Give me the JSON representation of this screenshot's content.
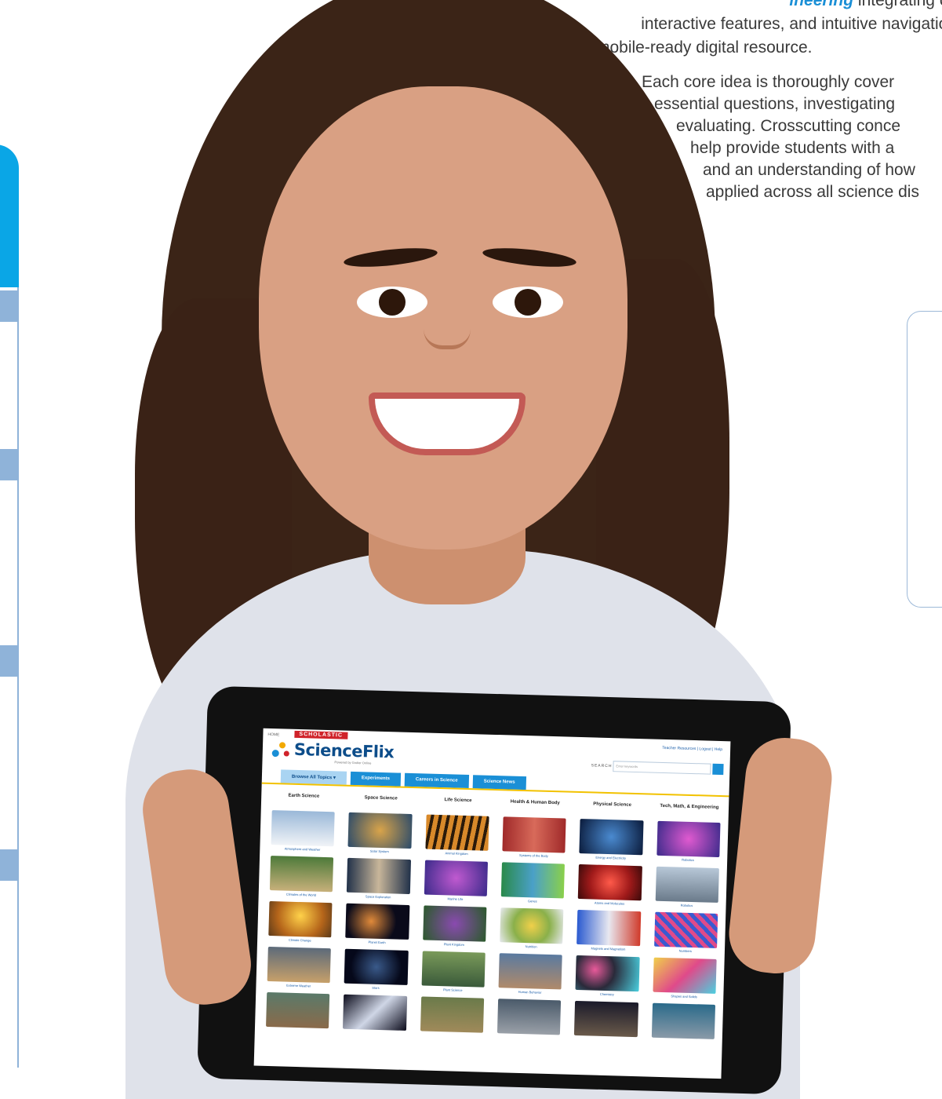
{
  "text": {
    "line0_hl": "ineering",
    "line0_tail": " integrating cu",
    "line1": "interactive features, and intuitive navigation",
    "line2": "mobile-ready digital resource.",
    "para2": [
      "Each core idea is thoroughly cover",
      "essential questions, investigating",
      "evaluating. Crosscutting conce",
      "help provide students with a",
      "and an understanding of how",
      "applied across all science dis"
    ]
  },
  "tablet": {
    "top_link": "HOME",
    "scholastic": "SCHOLASTIC",
    "logo": "ScienceFlix",
    "powered": "Powered by Grolier Online",
    "right_links": "Teacher Resources  |  Logout  |  Help",
    "search_label": "SEARCH",
    "search_placeholder": "Enter keywords",
    "tabs": [
      "Browse All Topics  ▾",
      "Experiments",
      "Careers in Science",
      "Science News"
    ],
    "columns": [
      {
        "head": "Earth Science",
        "tiles": [
          "Atmosphere and Weather",
          "Climates of the World",
          "Climate Change",
          "Extreme Weather",
          ""
        ]
      },
      {
        "head": "Space Science",
        "tiles": [
          "Solar System",
          "Space Exploration",
          "Planet Earth",
          "Stars",
          ""
        ]
      },
      {
        "head": "Life Science",
        "tiles": [
          "Animal Kingdom",
          "Marine Life",
          "Plant Kingdom",
          "Plant Science",
          ""
        ]
      },
      {
        "head": "Health & Human Body",
        "tiles": [
          "Systems of the Body",
          "Genes",
          "Nutrition",
          "Human Behavior",
          ""
        ]
      },
      {
        "head": "Physical Science",
        "tiles": [
          "Energy and Electricity",
          "Atoms and Molecules",
          "Magnets and Magnetism",
          "Chemistry",
          ""
        ]
      },
      {
        "head": "Tech, Math, & Engineering",
        "tiles": [
          "Robotics",
          "Robotics",
          "Numbers",
          "Shapes and Solids",
          ""
        ]
      }
    ]
  },
  "colors": {
    "accent": "#1a8fd6",
    "rail": "#0aa6e6",
    "text": "#3a3a3a"
  }
}
